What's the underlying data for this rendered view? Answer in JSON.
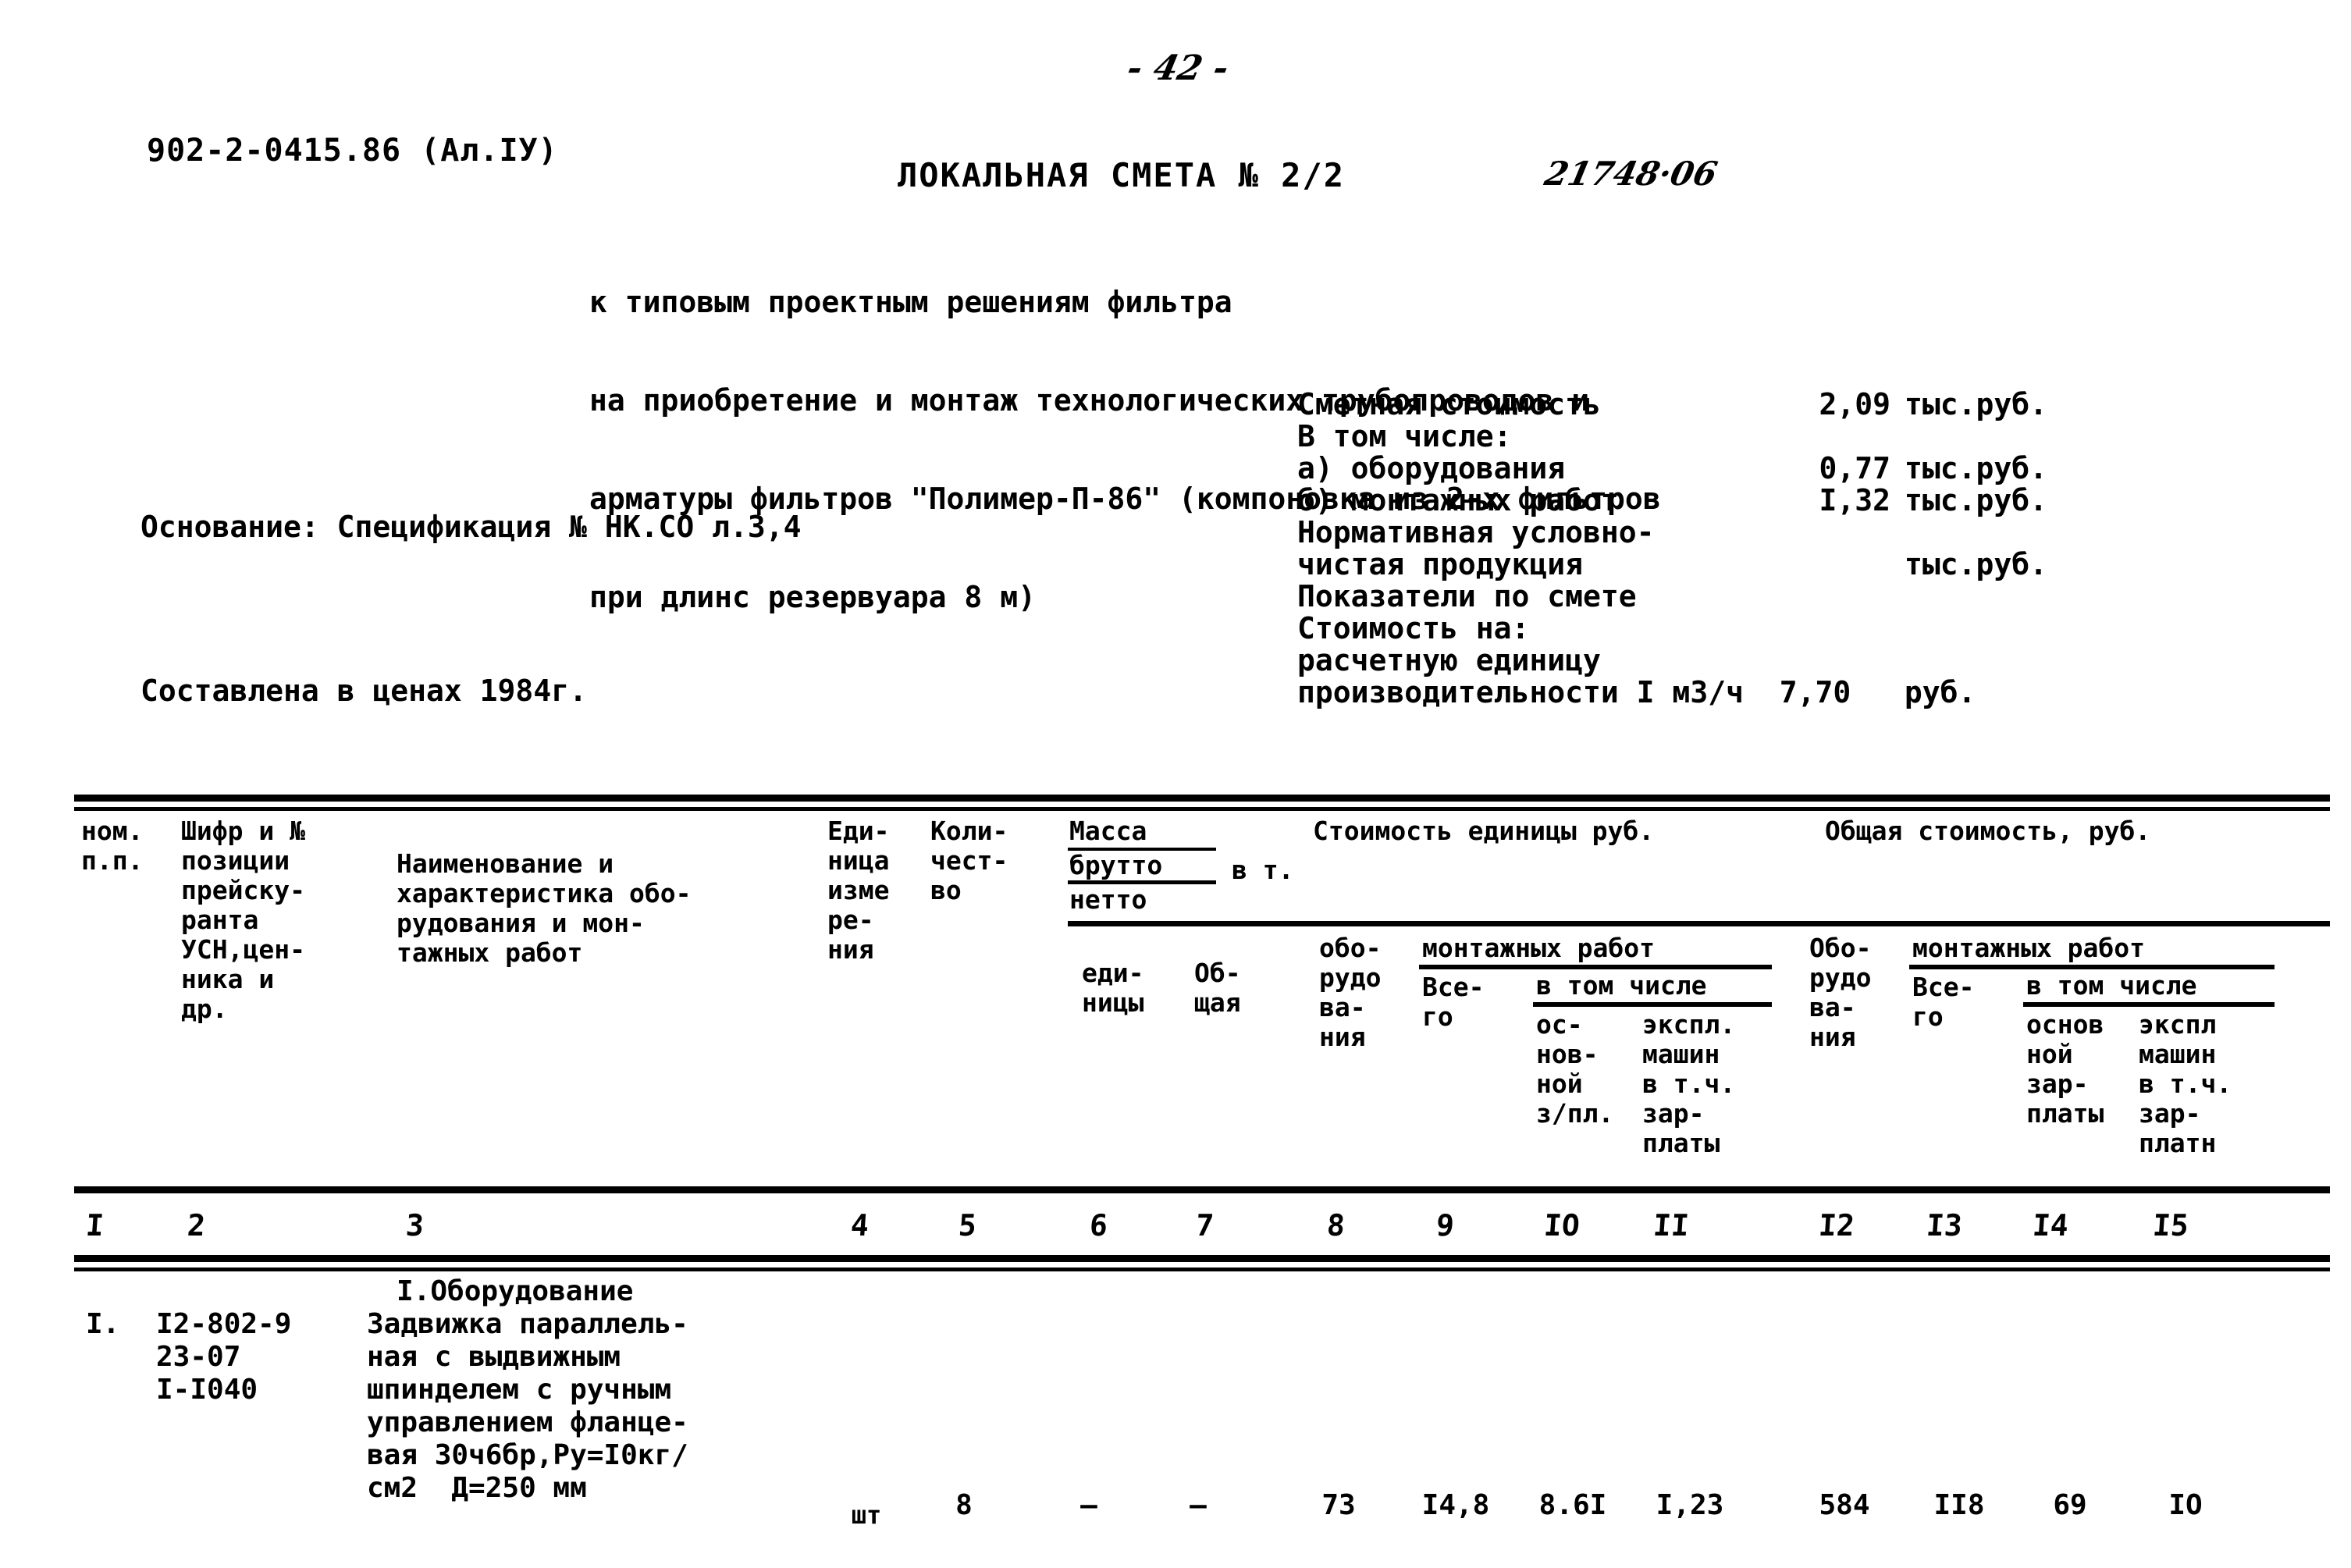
{
  "page": {
    "number": "- 42 -",
    "doc_code": "902-2-0415.86 (Ал.IУ)"
  },
  "header": {
    "title": "ЛОКАЛЬНАЯ СМЕТА № 2/2",
    "reference_handwritten": "21748·06",
    "subtitle_lines": [
      "к типовым проектным решениям фильтра",
      "на приобретение и монтаж технологических трубопроводов и",
      "арматуры фильтров \"Полимер-П-86\" (компоновка из 2-х фильтров",
      "при длинс резервуара 8 м)"
    ],
    "basis_lines": [
      "Основание: Спецификация № НК.СО л.3,4",
      "Составлена в ценах 1984г."
    ]
  },
  "summary": {
    "rows": [
      {
        "label": "Сметная стоимость",
        "value": "2,09",
        "unit": "тыс.руб."
      },
      {
        "label": "В том числе:",
        "value": "",
        "unit": ""
      },
      {
        "label": "а) оборудования",
        "value": "0,77",
        "unit": "тыс.руб."
      },
      {
        "label": "б) монтажных работ",
        "value": "I,32",
        "unit": "тыс.руб."
      },
      {
        "label": "Нормативная условно-",
        "value": "",
        "unit": ""
      },
      {
        "label": "чистая продукция",
        "value": "",
        "unit": "тыс.руб."
      },
      {
        "label": "Показатели по смете",
        "value": "",
        "unit": ""
      },
      {
        "label": "Стоимость на:",
        "value": "",
        "unit": ""
      },
      {
        "label": "расчетную единицу",
        "value": "",
        "unit": ""
      },
      {
        "label": "производительности I м3/ч  7,70   руб.",
        "value": "",
        "unit": ""
      }
    ]
  },
  "table": {
    "headers": {
      "col1": "ном.\nп.п.",
      "col2": "Шифр и №\nпозиции\nпрейску-\nранта\nУСН,цен-\nника и\nдр.",
      "col3": "Наименование и\nхарактеристика обо-\nрудования и мон-\nтажных работ",
      "col4": "Еди-\nница\nизме\nре-\nния",
      "col5": "Коли-\nчест-\nво",
      "mass_group": "Масса",
      "mass_brutto": "брутто",
      "mass_netto": "нетто",
      "mass_units": "в т.",
      "col6": "еди-\nницы",
      "col7": "Об-\nщая",
      "unit_cost_group": "Стоимость единицы руб.",
      "total_cost_group": "Общая стоимость, руб.",
      "col8": "обо-\nрудо\nва-\nния",
      "montazh_group_left": "монтажных работ",
      "col9": "Все-\nго",
      "vtch_left": "в том числе",
      "col10": "ос-\nнов-\nной\nз/пл.",
      "col11": "экспл.\nмашин\nв т.ч.\nзар-\nплаты",
      "col12": "Обо-\nрудо\nва-\nния",
      "montazh_group_right": "монтажных работ",
      "col13": "Все-\nго",
      "vtch_right": "в том числе",
      "col14": "основ\nной\nзар-\nплаты",
      "col15": "экспл\nмашин\nв т.ч.\nзар-\nплатн"
    },
    "column_numbers": [
      "I",
      "2",
      "3",
      "4",
      "5",
      "6",
      "7",
      "8",
      "9",
      "IO",
      "II",
      "I2",
      "I3",
      "I4",
      "I5"
    ],
    "section_title": "I.Оборудование",
    "rows": [
      {
        "num": "I.",
        "code": "I2-802-9\n23-07\nI-I040",
        "description": "Задвижка параллель-\nная с выдвижным\nшпинделем с ручным\nуправлением фланце-\nвая 30ч6бр,Ру=I0кг/\nсм2  Д=250 мм",
        "unit": "шт",
        "qty": "8",
        "mass_unit": "–",
        "mass_total": "–",
        "equip_unit": "73",
        "mont_total_unit": "I4,8",
        "mont_base_unit": "8.6I",
        "mont_mach_unit": "I,23",
        "equip_total": "584",
        "mont_total": "II8",
        "mont_base_total": "69",
        "mont_mach_total": "IO"
      }
    ]
  }
}
